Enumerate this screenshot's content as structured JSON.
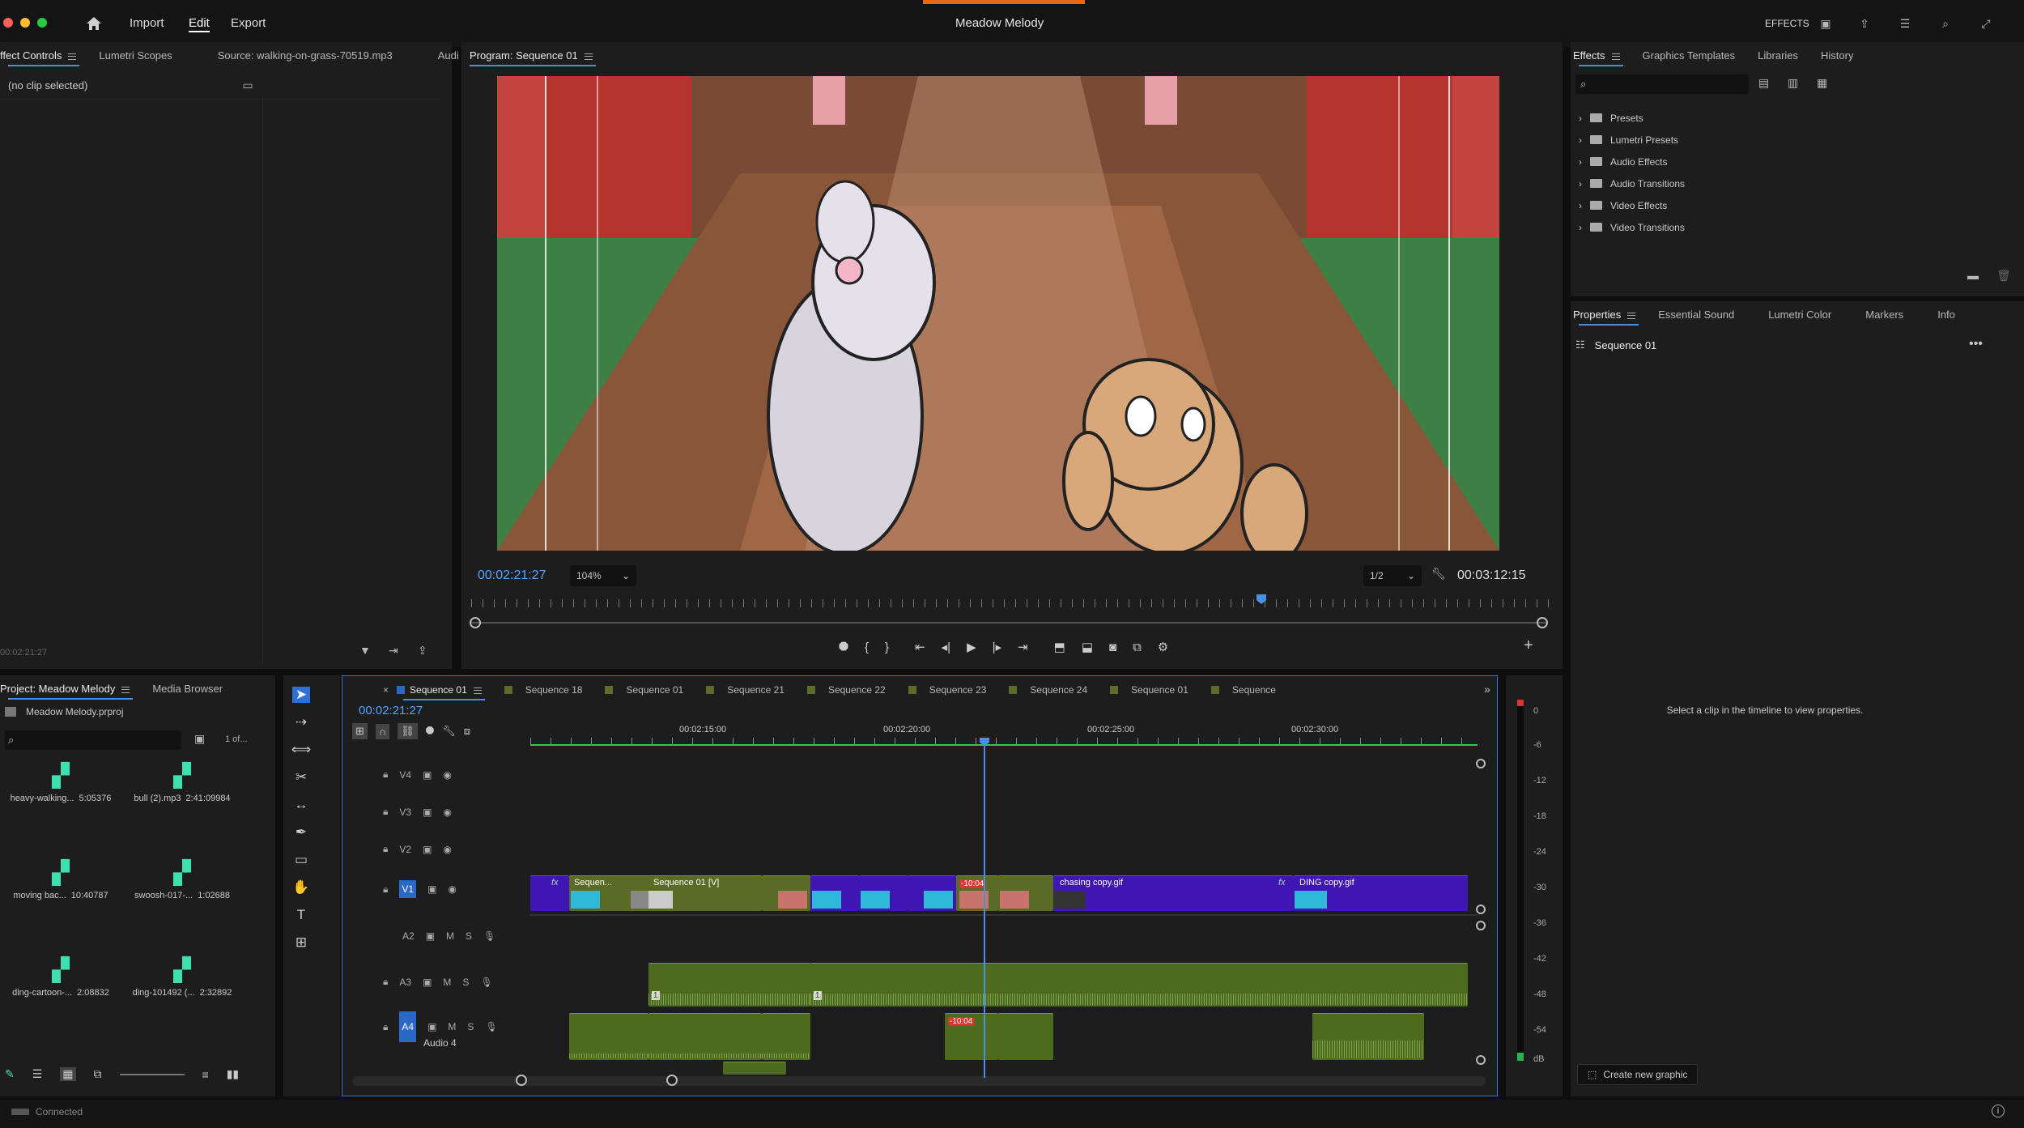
{
  "window": {
    "title": "Meadow Melody"
  },
  "menu": {
    "import": "Import",
    "edit": "Edit",
    "export": "Export",
    "effects_label": "EFFECTS"
  },
  "source_panel": {
    "tabs": [
      "ffect Controls",
      "Lumetri Scopes",
      "Source: walking-on-grass-70519.mp3",
      "Audi"
    ],
    "no_clip": "(no clip selected)",
    "timecode": "00:02:21:27"
  },
  "program": {
    "tab": "Program: Sequence 01",
    "timecode": "00:02:21:27",
    "zoom": "104%",
    "resolution": "1/2",
    "duration": "00:03:12:15"
  },
  "effects_panel": {
    "tabs": [
      "Effects",
      "Graphics Templates",
      "Libraries",
      "History"
    ],
    "items": [
      "Presets",
      "Lumetri Presets",
      "Audio Effects",
      "Audio Transitions",
      "Video Effects",
      "Video Transitions"
    ]
  },
  "properties_panel": {
    "tabs": [
      "Properties",
      "Essential Sound",
      "Lumetri Color",
      "Markers",
      "Info"
    ],
    "sequence": "Sequence 01",
    "hint": "Select a clip in the timeline to view properties.",
    "create_graphic": "Create new graphic"
  },
  "project_panel": {
    "tabs": [
      "Project: Meadow Melody",
      "Media Browser"
    ],
    "file": "Meadow Melody.prproj",
    "count": "1 of...",
    "items": [
      {
        "name": "heavy-walking...",
        "duration": "5:05376"
      },
      {
        "name": "bull (2).mp3",
        "duration": "2:41:09984"
      },
      {
        "name": "moving bac...",
        "duration": "10:40787"
      },
      {
        "name": "swoosh-017-...",
        "duration": "1:02688"
      },
      {
        "name": "ding-cartoon-...",
        "duration": "2:08832"
      },
      {
        "name": "ding-101492 (...",
        "duration": "2:32892"
      }
    ]
  },
  "timeline": {
    "tabs": [
      "Sequence 01",
      "Sequence 18",
      "Sequence 01",
      "Sequence 21",
      "Sequence 22",
      "Sequence 23",
      "Sequence 24",
      "Sequence 01",
      "Sequence"
    ],
    "timecode": "00:02:21:27",
    "ruler": [
      "00:02:15:00",
      "00:02:20:00",
      "00:02:25:00",
      "00:02:30:00"
    ],
    "video_tracks": [
      "V4",
      "V3",
      "V2",
      "V1"
    ],
    "audio_tracks": [
      "A2",
      "A3",
      "A4"
    ],
    "audio4_name": "Audio 4",
    "m": "M",
    "s": "S",
    "clips": {
      "seq_short": "Sequen...",
      "seq01v": "Sequence 01 [V]",
      "chasing": "chasing copy.gif",
      "ding": "DING copy.gif",
      "marker": "-10:04",
      "audio_marker": "-10:04",
      "a3_label": "1",
      "a3_label2": "1"
    }
  },
  "meter": {
    "labels": [
      "0",
      "-6",
      "-12",
      "-18",
      "-24",
      "-30",
      "-36",
      "-42",
      "-48",
      "-54",
      "dB"
    ]
  },
  "status": {
    "text": "Connected"
  }
}
